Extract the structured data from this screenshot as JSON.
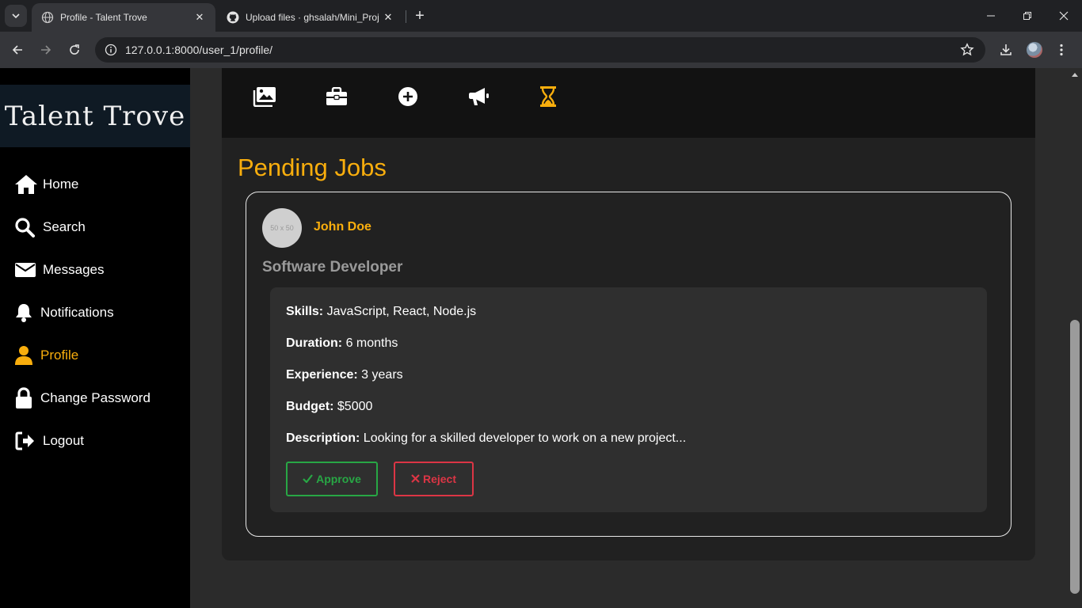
{
  "browser": {
    "tabs": [
      {
        "title": "Profile - Talent Trove",
        "active": true
      },
      {
        "title": "Upload files · ghsalah/Mini_Proj",
        "active": false
      }
    ],
    "url": "127.0.0.1:8000/user_1/profile/"
  },
  "sidebar": {
    "brand": "Talent Trove",
    "items": [
      {
        "label": "Home",
        "icon": "home-icon"
      },
      {
        "label": "Search",
        "icon": "search-icon"
      },
      {
        "label": "Messages",
        "icon": "envelope-icon"
      },
      {
        "label": "Notifications",
        "icon": "bell-icon"
      },
      {
        "label": "Profile",
        "icon": "user-icon",
        "active": true
      },
      {
        "label": "Change Password",
        "icon": "lock-icon"
      },
      {
        "label": "Logout",
        "icon": "logout-icon"
      }
    ]
  },
  "iconbar": {
    "icons": [
      "images-icon",
      "briefcase-icon",
      "plus-circle-icon",
      "megaphone-icon",
      "hourglass-icon"
    ],
    "active": "hourglass-icon"
  },
  "pending": {
    "title": "Pending Jobs",
    "job": {
      "avatar_text": "50 x 50",
      "user": "John Doe",
      "title": "Software Developer",
      "skills_label": "Skills:",
      "skills": "JavaScript, React, Node.js",
      "duration_label": "Duration:",
      "duration": "6 months",
      "experience_label": "Experience:",
      "experience": "3 years",
      "budget_label": "Budget:",
      "budget": "$5000",
      "description_label": "Description:",
      "description": "Looking for a skilled developer to work on a new project...",
      "approve_label": "Approve",
      "reject_label": "Reject"
    }
  },
  "colors": {
    "accent": "#f9ae0d",
    "approve": "#28a745",
    "reject": "#dc3545"
  }
}
